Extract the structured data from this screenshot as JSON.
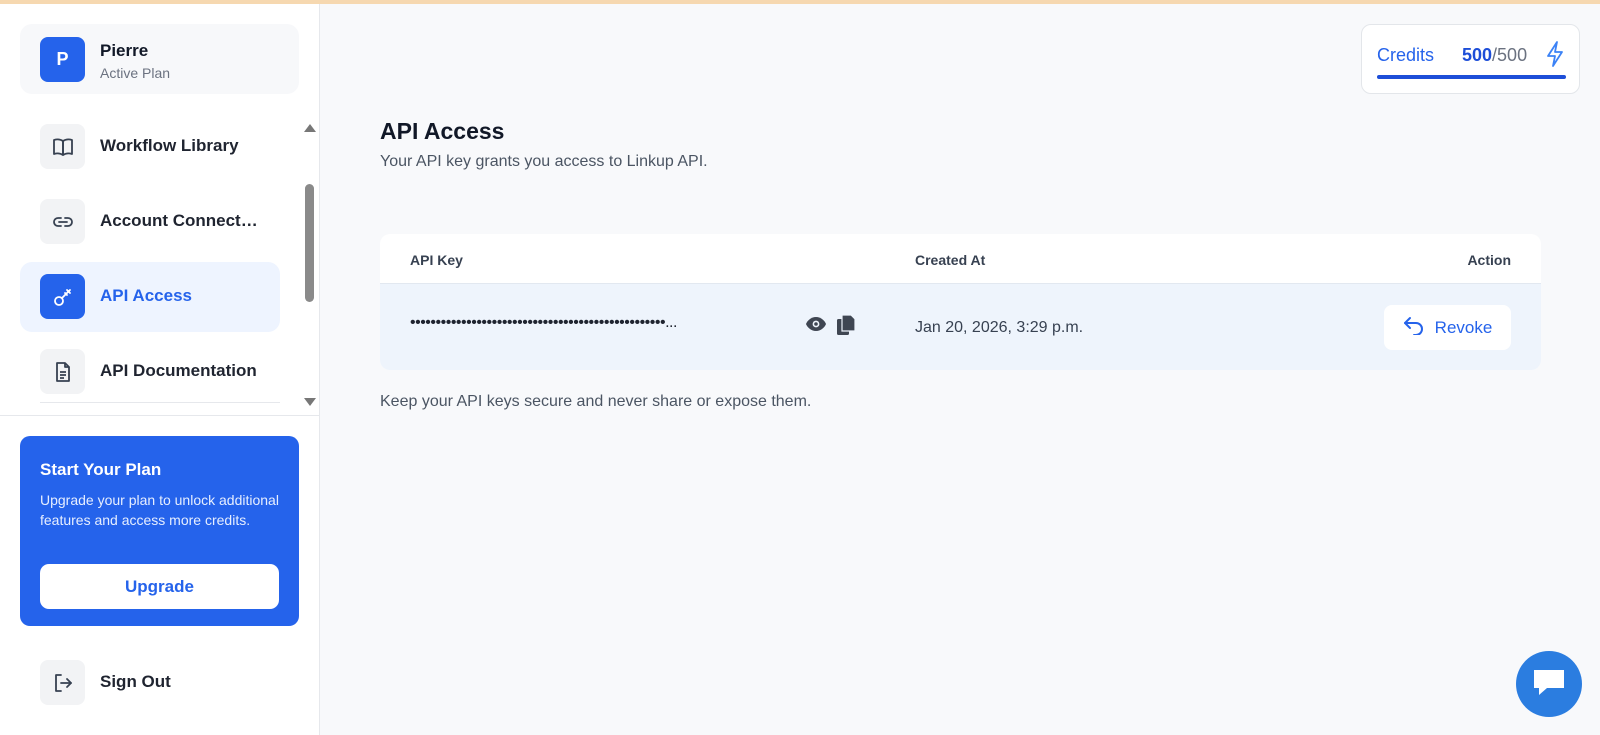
{
  "user": {
    "initial": "P",
    "name": "Pierre",
    "plan": "Active Plan"
  },
  "nav": {
    "items": [
      {
        "label": "Workflow Library",
        "icon": "book-icon",
        "active": false
      },
      {
        "label": "Account Connections",
        "icon": "link-icon",
        "active": false
      },
      {
        "label": "API Access",
        "icon": "key-icon",
        "active": true
      },
      {
        "label": "API Documentation",
        "icon": "document-icon",
        "active": false
      }
    ]
  },
  "plan_card": {
    "title": "Start Your Plan",
    "description": "Upgrade your plan to unlock additional features and access more credits.",
    "button_label": "Upgrade"
  },
  "signout": {
    "label": "Sign Out",
    "icon": "sign-out-icon"
  },
  "credits": {
    "label": "Credits",
    "used": "500",
    "total": "/500",
    "fill_fraction": 1.0,
    "icon": "lightning-icon"
  },
  "page": {
    "title": "API Access",
    "subtitle": "Your API key grants you access to Linkup API.",
    "note": "Keep your API keys secure and never share or expose them."
  },
  "table": {
    "headers": {
      "key": "API Key",
      "created": "Created At",
      "action": "Action"
    },
    "rows": [
      {
        "key_masked": "••••••••••••••••••••••••••••••••••••••••••••••••••...",
        "created_at": "Jan 20, 2026, 3:29 p.m.",
        "action_label": "Revoke"
      }
    ]
  },
  "colors": {
    "accent": "#2563eb",
    "active_bg": "#eef4ff",
    "row_bg": "#eef4fc",
    "chat": "#2b7de0"
  }
}
